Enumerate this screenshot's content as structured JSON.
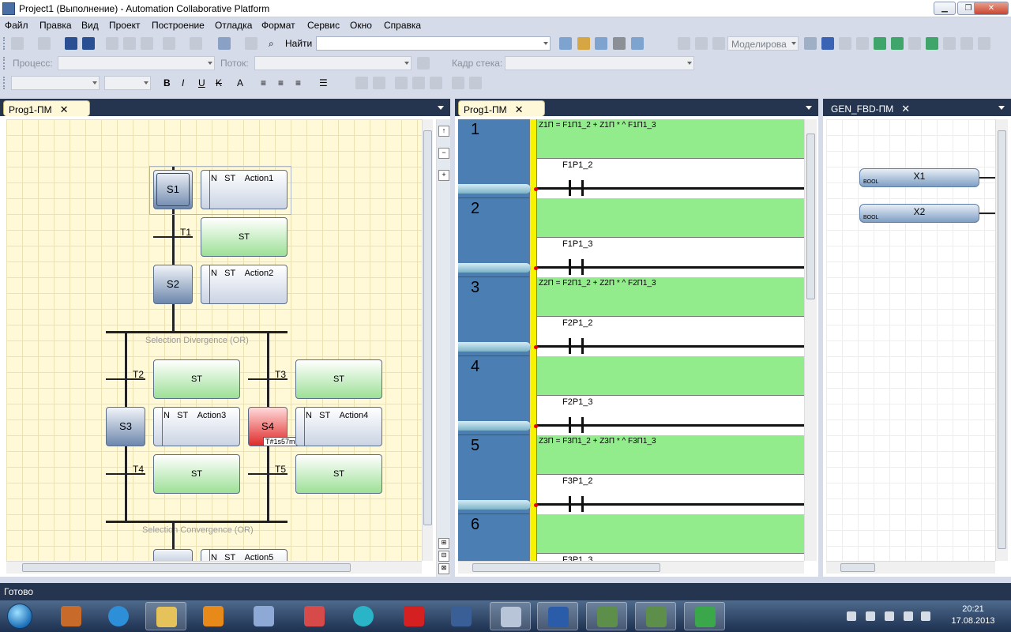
{
  "window": {
    "title": "Project1 (Выполнение) - Automation Collaborative Platform"
  },
  "menu": [
    "Файл",
    "Правка",
    "Вид",
    "Проект",
    "Построение",
    "Отладка",
    "Формат",
    "Сервис",
    "Окно",
    "Справка"
  ],
  "toolbar1": {
    "find_label": "Найти",
    "find_value": "",
    "sim_combo": "Моделирова"
  },
  "toolbar2": {
    "process_label": "Процесс:",
    "thread_label": "Поток:",
    "stack_label": "Кадр стека:"
  },
  "pane_sfc": {
    "tab": "Prog1-ПМ",
    "steps": {
      "s1": "S1",
      "s2": "S2",
      "s3": "S3",
      "s4": "S4"
    },
    "transitions": {
      "t1": "T1",
      "t2": "T2",
      "t3": "T3",
      "t4": "T4",
      "t5": "T5"
    },
    "actions": {
      "a1": "N   ST    Action1",
      "a2": "N   ST    Action2",
      "a3": "N   ST    Action3",
      "a4": "N   ST    Action4",
      "a5": "N   ST    Action5"
    },
    "st_label": "ST",
    "divergence": "Selection Divergence (OR)",
    "convergence": "Selection Convergence (OR)",
    "timer": "T#1s57m"
  },
  "pane_ld": {
    "tab": "Prog1-ПМ",
    "rungs": [
      {
        "num": "1",
        "expr": "Z1П = F1П1_2 + Z1П * ^ F1П1_3",
        "var": "F1P1_2"
      },
      {
        "num": "2",
        "expr": "",
        "var": "F1P1_3"
      },
      {
        "num": "3",
        "expr": "Z2П = F2П1_2 + Z2П * ^ F2П1_3",
        "var": "F2P1_2"
      },
      {
        "num": "4",
        "expr": "",
        "var": "F2P1_3"
      },
      {
        "num": "5",
        "expr": "Z3П = F3П1_2 + Z3П * ^ F3П1_3",
        "var": "F3P1_2"
      },
      {
        "num": "6",
        "expr": "",
        "var": "F3P1_3"
      }
    ]
  },
  "pane_fbd": {
    "tab": "GEN_FBD-ПМ",
    "blocks": [
      {
        "name": "X1",
        "type": "BOOL"
      },
      {
        "name": "X2",
        "type": "BOOL"
      }
    ]
  },
  "status": "Готово",
  "clock": {
    "time": "20:21",
    "date": "17.08.2013"
  },
  "colors": {
    "accent": "#25354f",
    "ld_green": "#92ec8c",
    "ld_rail": "#4b7fb3",
    "grid_bg": "#fff9d8",
    "active_step": "#e02a2a"
  }
}
